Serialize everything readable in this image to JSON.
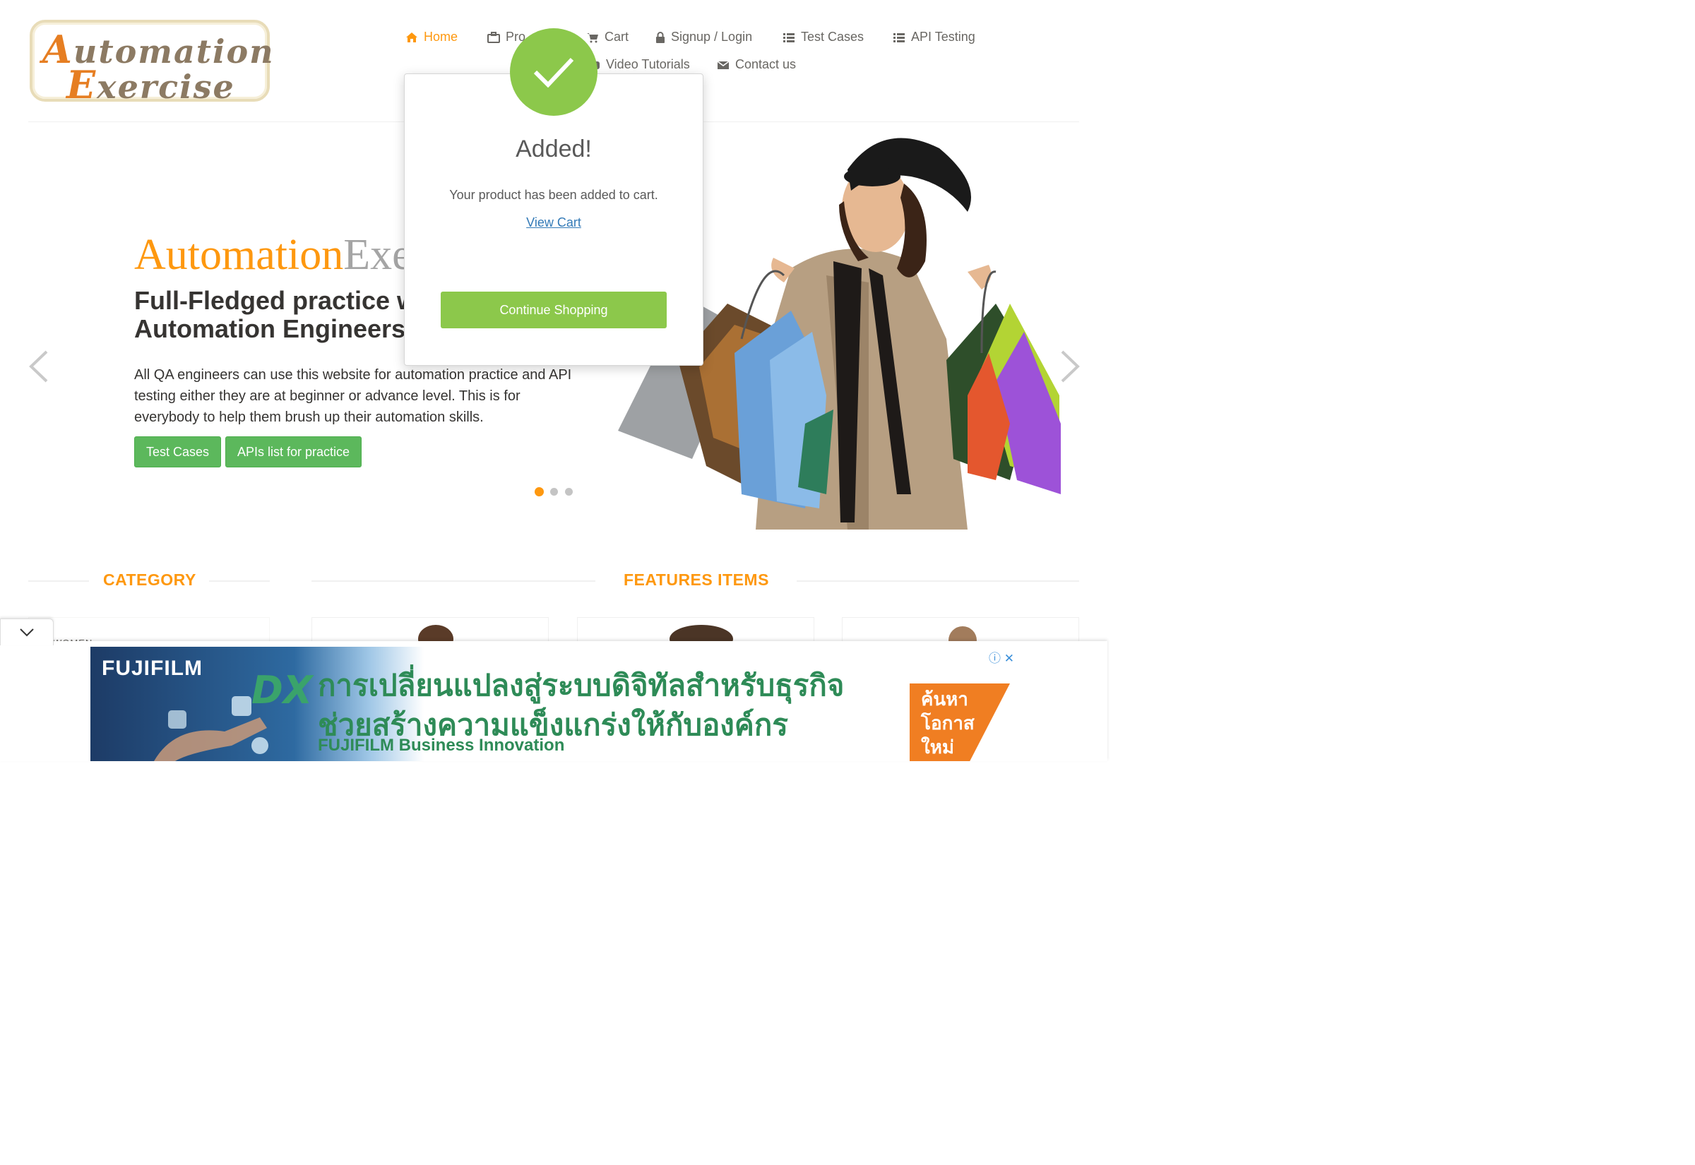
{
  "logo": {
    "line1_cap": "A",
    "line1_rest": "utomation",
    "line2_cap": "E",
    "line2_rest": "xercise"
  },
  "nav": {
    "items": [
      {
        "label": "Home",
        "icon": "home-icon",
        "active": true
      },
      {
        "label": "Pro",
        "icon": "briefcase-icon"
      },
      {
        "label": "Cart",
        "icon": "cart-icon"
      },
      {
        "label": "Signup / Login",
        "icon": "lock-icon"
      },
      {
        "label": "Test Cases",
        "icon": "list-icon"
      },
      {
        "label": "API Testing",
        "icon": "list-icon"
      },
      {
        "label": "Video Tutorials",
        "icon": "youtube-icon"
      },
      {
        "label": "Contact us",
        "icon": "envelope-icon"
      }
    ]
  },
  "hero": {
    "brand_a": "Automation",
    "brand_b": "Exe",
    "headline": "Full-Fledged practice w\nAutomation Engineers",
    "text": "All QA engineers can use this website for automation practice and API testing either they are at beginner or advance level. This is for everybody to help them brush up their automation skills.",
    "buttons": [
      "Test Cases",
      "APIs list for practice"
    ],
    "active_slide": 1,
    "slides": 3
  },
  "sections": {
    "category": "CATEGORY",
    "features": "FEATURES ITEMS",
    "category_first": "WOMEN"
  },
  "modal": {
    "title": "Added!",
    "body": "Your product has been added to cart.",
    "link": "View Cart",
    "button": "Continue Shopping"
  },
  "ad": {
    "brand": "FUJIFILM",
    "dx": "DX",
    "line1": "การเปลี่ยนแปลงสู่ระบบดิจิทัลสำหรับธุรกิจ",
    "line2": "ช่วยสร้างความแข็งแกร่งให้กับองค์กร",
    "sub": "FUJIFILM Business Innovation",
    "cta": "ค้นหา\nโอกาส\nใหม่",
    "close": "ⓘ ✕"
  },
  "colors": {
    "accent": "#FE980F",
    "success": "#8CC84B",
    "button": "#5CB85C",
    "link": "#337AB7"
  }
}
